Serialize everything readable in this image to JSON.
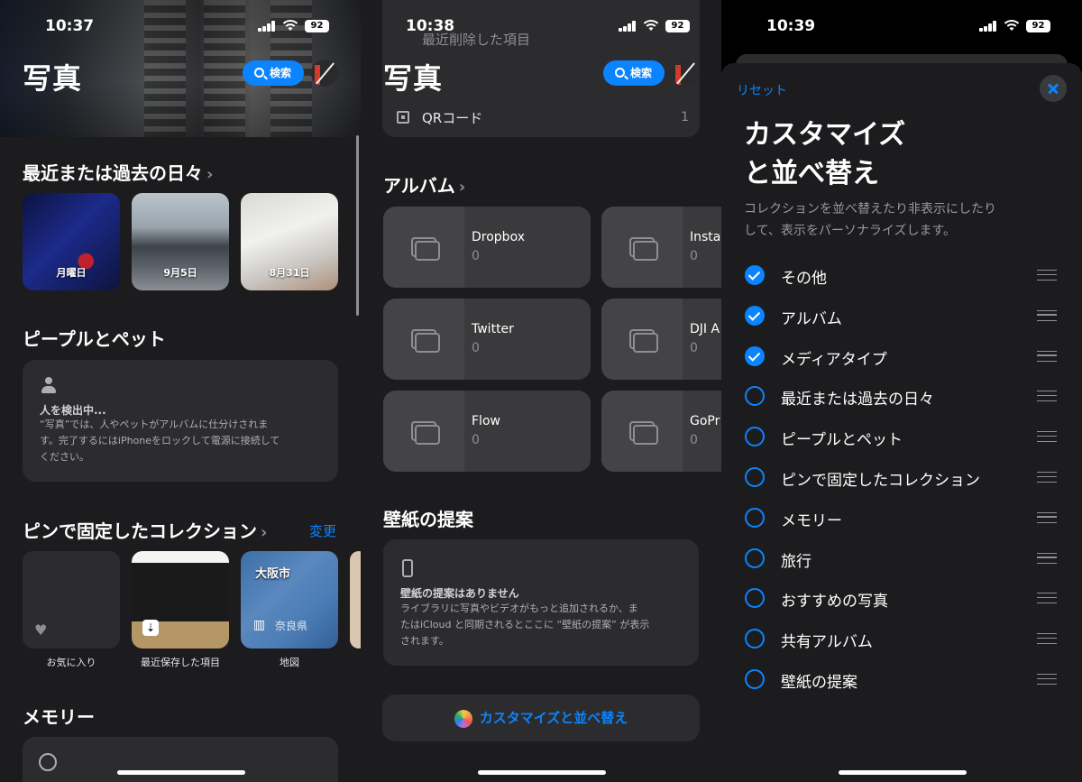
{
  "status": {
    "battery": "92"
  },
  "screen1": {
    "time": "10:37",
    "title": "写真",
    "search_label": "検索",
    "recent": {
      "title": "最近または過去の日々",
      "items": [
        {
          "label": "月曜日"
        },
        {
          "label": "9月5日"
        },
        {
          "label": "8月31日"
        }
      ]
    },
    "people": {
      "title": "ピープルとペット",
      "card_title": "人を検出中...",
      "card_body_1": "“写真”では、人やペットがアルバムに仕分けされま",
      "card_body_2": "す。完了するにはiPhoneをロックして電源に接続して",
      "card_body_3": "ください。"
    },
    "pinned": {
      "title": "ピンで固定したコレクション",
      "edit": "変更",
      "items": [
        {
          "label": "お気に入り"
        },
        {
          "label": "最近保存した項目"
        },
        {
          "label": "地図",
          "map_city": "大阪市",
          "map_pref": "奈良県"
        }
      ]
    },
    "memories": {
      "title": "メモリー"
    }
  },
  "screen2": {
    "time": "10:38",
    "title": "写真",
    "search_label": "検索",
    "top_rows": [
      "最近削除した項目"
    ],
    "qr": {
      "label": "QRコード",
      "count": "1"
    },
    "albums_title": "アルバム",
    "albums": [
      {
        "name": "Dropbox",
        "count": "0"
      },
      {
        "name": "Insta",
        "count": "0"
      },
      {
        "name": "Twitter",
        "count": "0"
      },
      {
        "name": "DJI A",
        "count": "0"
      },
      {
        "name": "Flow",
        "count": "0"
      },
      {
        "name": "GoPr",
        "count": "0"
      }
    ],
    "wallpaper": {
      "title": "壁紙の提案",
      "card_title": "壁紙の提案はありません",
      "body_1": "ライブラリに写真やビデオがもっと追加されるか、ま",
      "body_2": "たはiCloud と同期されるとここに “壁紙の提案” が表示",
      "body_3": "されます。"
    },
    "customize_label": "カスタマイズと並べ替え"
  },
  "screen3": {
    "time": "10:39",
    "reset": "リセット",
    "title_1": "カスタマイズ",
    "title_2": "と並べ替え",
    "desc_1": "コレクションを並べ替えたり非表示にしたり",
    "desc_2": "して、表示をパーソナライズします。",
    "options": [
      {
        "label": "その他",
        "checked": true
      },
      {
        "label": "アルバム",
        "checked": true
      },
      {
        "label": "メディアタイプ",
        "checked": true
      },
      {
        "label": "最近または過去の日々",
        "checked": false
      },
      {
        "label": "ピープルとペット",
        "checked": false
      },
      {
        "label": "ピンで固定したコレクション",
        "checked": false
      },
      {
        "label": "メモリー",
        "checked": false
      },
      {
        "label": "旅行",
        "checked": false
      },
      {
        "label": "おすすめの写真",
        "checked": false
      },
      {
        "label": "共有アルバム",
        "checked": false
      },
      {
        "label": "壁紙の提案",
        "checked": false
      }
    ]
  },
  "colors": {
    "accent": "#0a84ff",
    "card": "#2c2c2e",
    "background": "#1c1c1e"
  }
}
